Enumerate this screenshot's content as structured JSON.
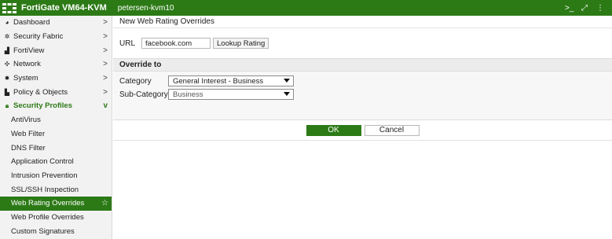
{
  "header": {
    "app_title": "FortiGate VM64-KVM",
    "hostname": "petersen-kvm10",
    "icons": [
      "cli-console-icon",
      "fullscreen-icon",
      "more-icon"
    ]
  },
  "sidebar": {
    "items": [
      {
        "label": "Dashboard",
        "icon": "dashboard-icon",
        "chevron": ">"
      },
      {
        "label": "Security Fabric",
        "icon": "security-fabric-icon",
        "chevron": ">"
      },
      {
        "label": "FortiView",
        "icon": "fortiview-icon",
        "chevron": ">"
      },
      {
        "label": "Network",
        "icon": "network-icon",
        "chevron": ">"
      },
      {
        "label": "System",
        "icon": "system-gear-icon",
        "chevron": ">"
      },
      {
        "label": "Policy & Objects",
        "icon": "policy-icon",
        "chevron": ">"
      },
      {
        "label": "Security Profiles",
        "icon": "lock-icon",
        "chevron": "v"
      }
    ],
    "sub_items": [
      "AntiVirus",
      "Web Filter",
      "DNS Filter",
      "Application Control",
      "Intrusion Prevention",
      "SSL/SSH Inspection",
      "Web Rating Overrides",
      "Web Profile Overrides",
      "Custom Signatures"
    ],
    "active_item": "Web Rating Overrides"
  },
  "main": {
    "title": "New Web Rating Overrides",
    "url_label": "URL",
    "url_value": "facebook.com",
    "lookup_button": "Lookup Rating",
    "override_heading": "Override to",
    "category_label": "Category",
    "category_value": "General Interest - Business",
    "subcategory_label": "Sub-Category",
    "subcategory_value": "Business",
    "ok_button": "OK",
    "cancel_button": "Cancel"
  },
  "colors": {
    "brand_green": "#2c7a16",
    "sidebar_bg": "#f2f2f2"
  }
}
